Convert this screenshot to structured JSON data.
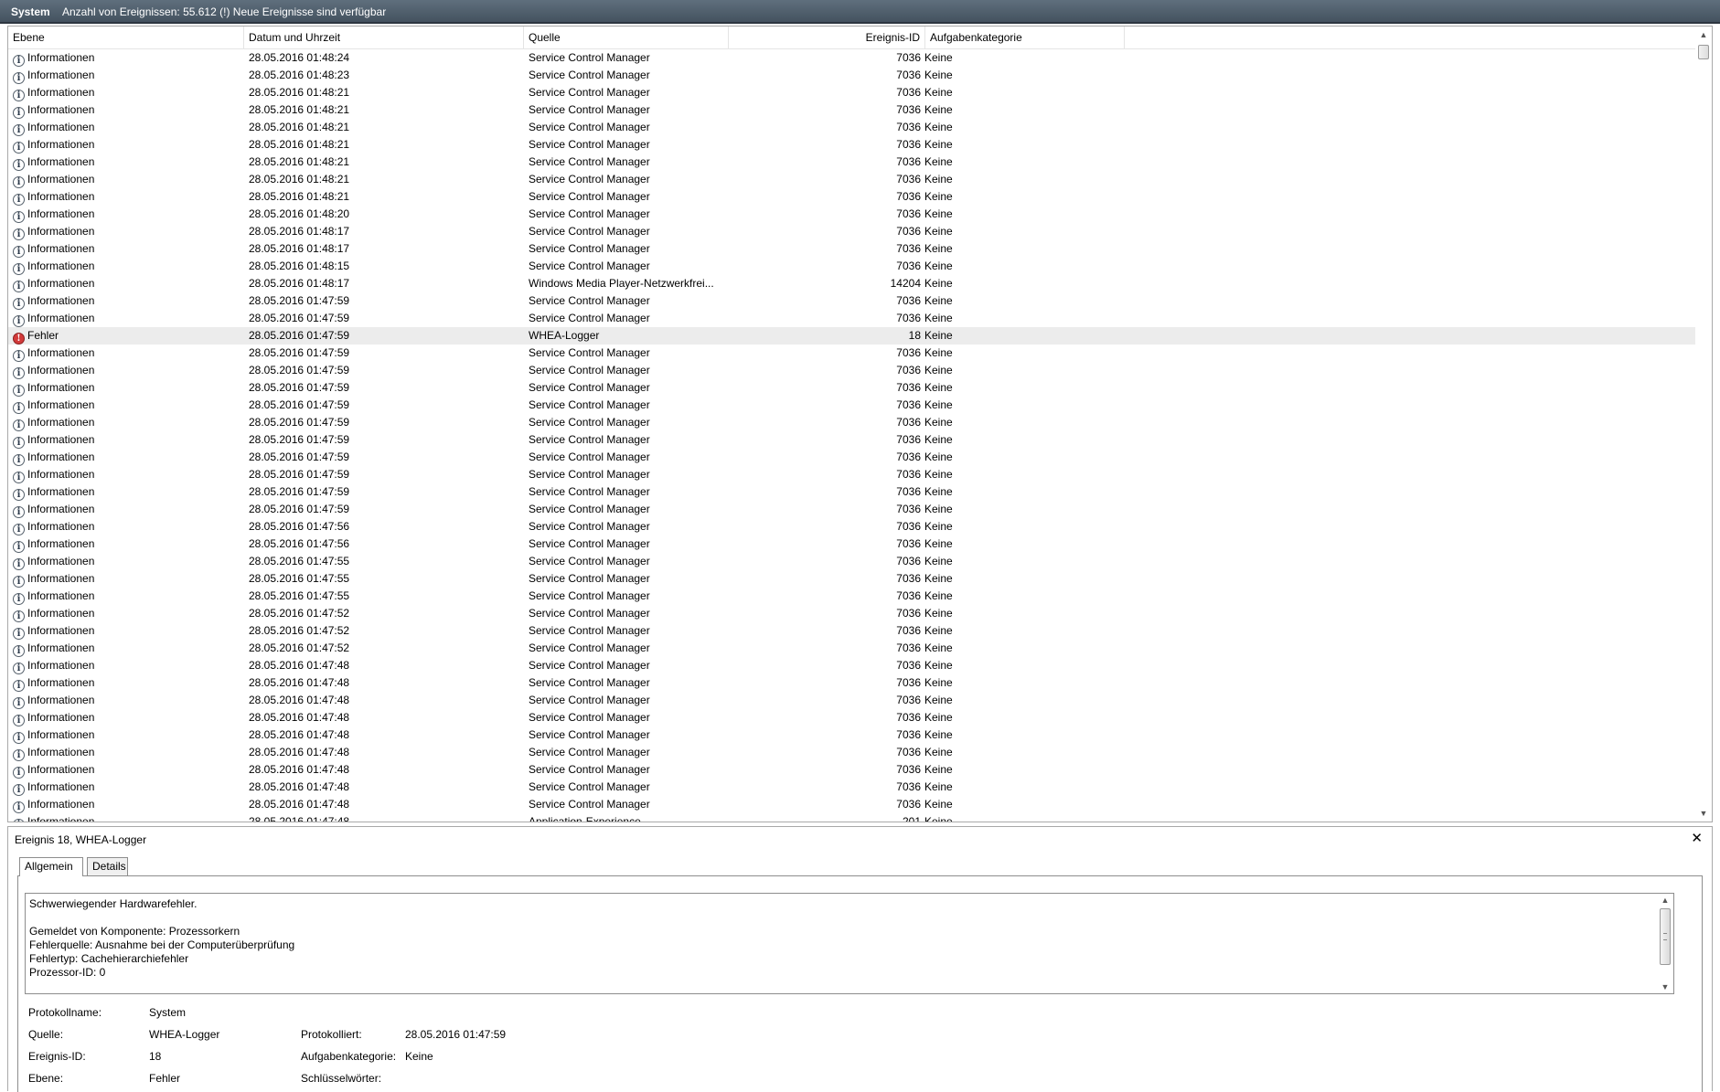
{
  "header": {
    "title": "System",
    "count_text": "Anzahl von Ereignissen: 55.612 (!) Neue Ereignisse sind verfügbar"
  },
  "columns": [
    "Ebene",
    "Datum und Uhrzeit",
    "Quelle",
    "Ereignis-ID",
    "Aufgabenkategorie"
  ],
  "icons": {
    "info": "information-icon",
    "error": "error-icon"
  },
  "colors": {
    "selected_row": "#ececec",
    "error_icon": "#d23a3a",
    "title_bar": "#4f5d6a"
  },
  "events": [
    {
      "level": "Informationen",
      "date": "28.05.2016 01:48:24",
      "source": "Service Control Manager",
      "id": "7036",
      "category": "Keine"
    },
    {
      "level": "Informationen",
      "date": "28.05.2016 01:48:23",
      "source": "Service Control Manager",
      "id": "7036",
      "category": "Keine"
    },
    {
      "level": "Informationen",
      "date": "28.05.2016 01:48:21",
      "source": "Service Control Manager",
      "id": "7036",
      "category": "Keine"
    },
    {
      "level": "Informationen",
      "date": "28.05.2016 01:48:21",
      "source": "Service Control Manager",
      "id": "7036",
      "category": "Keine"
    },
    {
      "level": "Informationen",
      "date": "28.05.2016 01:48:21",
      "source": "Service Control Manager",
      "id": "7036",
      "category": "Keine"
    },
    {
      "level": "Informationen",
      "date": "28.05.2016 01:48:21",
      "source": "Service Control Manager",
      "id": "7036",
      "category": "Keine"
    },
    {
      "level": "Informationen",
      "date": "28.05.2016 01:48:21",
      "source": "Service Control Manager",
      "id": "7036",
      "category": "Keine"
    },
    {
      "level": "Informationen",
      "date": "28.05.2016 01:48:21",
      "source": "Service Control Manager",
      "id": "7036",
      "category": "Keine"
    },
    {
      "level": "Informationen",
      "date": "28.05.2016 01:48:21",
      "source": "Service Control Manager",
      "id": "7036",
      "category": "Keine"
    },
    {
      "level": "Informationen",
      "date": "28.05.2016 01:48:20",
      "source": "Service Control Manager",
      "id": "7036",
      "category": "Keine"
    },
    {
      "level": "Informationen",
      "date": "28.05.2016 01:48:17",
      "source": "Service Control Manager",
      "id": "7036",
      "category": "Keine"
    },
    {
      "level": "Informationen",
      "date": "28.05.2016 01:48:17",
      "source": "Service Control Manager",
      "id": "7036",
      "category": "Keine"
    },
    {
      "level": "Informationen",
      "date": "28.05.2016 01:48:15",
      "source": "Service Control Manager",
      "id": "7036",
      "category": "Keine"
    },
    {
      "level": "Informationen",
      "date": "28.05.2016 01:48:17",
      "source": "Windows Media Player-Netzwerkfrei...",
      "id": "14204",
      "category": "Keine"
    },
    {
      "level": "Informationen",
      "date": "28.05.2016 01:47:59",
      "source": "Service Control Manager",
      "id": "7036",
      "category": "Keine"
    },
    {
      "level": "Informationen",
      "date": "28.05.2016 01:47:59",
      "source": "Service Control Manager",
      "id": "7036",
      "category": "Keine"
    },
    {
      "level": "Fehler",
      "date": "28.05.2016 01:47:59",
      "source": "WHEA-Logger",
      "id": "18",
      "category": "Keine",
      "selected": true
    },
    {
      "level": "Informationen",
      "date": "28.05.2016 01:47:59",
      "source": "Service Control Manager",
      "id": "7036",
      "category": "Keine"
    },
    {
      "level": "Informationen",
      "date": "28.05.2016 01:47:59",
      "source": "Service Control Manager",
      "id": "7036",
      "category": "Keine"
    },
    {
      "level": "Informationen",
      "date": "28.05.2016 01:47:59",
      "source": "Service Control Manager",
      "id": "7036",
      "category": "Keine"
    },
    {
      "level": "Informationen",
      "date": "28.05.2016 01:47:59",
      "source": "Service Control Manager",
      "id": "7036",
      "category": "Keine"
    },
    {
      "level": "Informationen",
      "date": "28.05.2016 01:47:59",
      "source": "Service Control Manager",
      "id": "7036",
      "category": "Keine"
    },
    {
      "level": "Informationen",
      "date": "28.05.2016 01:47:59",
      "source": "Service Control Manager",
      "id": "7036",
      "category": "Keine"
    },
    {
      "level": "Informationen",
      "date": "28.05.2016 01:47:59",
      "source": "Service Control Manager",
      "id": "7036",
      "category": "Keine"
    },
    {
      "level": "Informationen",
      "date": "28.05.2016 01:47:59",
      "source": "Service Control Manager",
      "id": "7036",
      "category": "Keine"
    },
    {
      "level": "Informationen",
      "date": "28.05.2016 01:47:59",
      "source": "Service Control Manager",
      "id": "7036",
      "category": "Keine"
    },
    {
      "level": "Informationen",
      "date": "28.05.2016 01:47:59",
      "source": "Service Control Manager",
      "id": "7036",
      "category": "Keine"
    },
    {
      "level": "Informationen",
      "date": "28.05.2016 01:47:56",
      "source": "Service Control Manager",
      "id": "7036",
      "category": "Keine"
    },
    {
      "level": "Informationen",
      "date": "28.05.2016 01:47:56",
      "source": "Service Control Manager",
      "id": "7036",
      "category": "Keine"
    },
    {
      "level": "Informationen",
      "date": "28.05.2016 01:47:55",
      "source": "Service Control Manager",
      "id": "7036",
      "category": "Keine"
    },
    {
      "level": "Informationen",
      "date": "28.05.2016 01:47:55",
      "source": "Service Control Manager",
      "id": "7036",
      "category": "Keine"
    },
    {
      "level": "Informationen",
      "date": "28.05.2016 01:47:55",
      "source": "Service Control Manager",
      "id": "7036",
      "category": "Keine"
    },
    {
      "level": "Informationen",
      "date": "28.05.2016 01:47:52",
      "source": "Service Control Manager",
      "id": "7036",
      "category": "Keine"
    },
    {
      "level": "Informationen",
      "date": "28.05.2016 01:47:52",
      "source": "Service Control Manager",
      "id": "7036",
      "category": "Keine"
    },
    {
      "level": "Informationen",
      "date": "28.05.2016 01:47:52",
      "source": "Service Control Manager",
      "id": "7036",
      "category": "Keine"
    },
    {
      "level": "Informationen",
      "date": "28.05.2016 01:47:48",
      "source": "Service Control Manager",
      "id": "7036",
      "category": "Keine"
    },
    {
      "level": "Informationen",
      "date": "28.05.2016 01:47:48",
      "source": "Service Control Manager",
      "id": "7036",
      "category": "Keine"
    },
    {
      "level": "Informationen",
      "date": "28.05.2016 01:47:48",
      "source": "Service Control Manager",
      "id": "7036",
      "category": "Keine"
    },
    {
      "level": "Informationen",
      "date": "28.05.2016 01:47:48",
      "source": "Service Control Manager",
      "id": "7036",
      "category": "Keine"
    },
    {
      "level": "Informationen",
      "date": "28.05.2016 01:47:48",
      "source": "Service Control Manager",
      "id": "7036",
      "category": "Keine"
    },
    {
      "level": "Informationen",
      "date": "28.05.2016 01:47:48",
      "source": "Service Control Manager",
      "id": "7036",
      "category": "Keine"
    },
    {
      "level": "Informationen",
      "date": "28.05.2016 01:47:48",
      "source": "Service Control Manager",
      "id": "7036",
      "category": "Keine"
    },
    {
      "level": "Informationen",
      "date": "28.05.2016 01:47:48",
      "source": "Service Control Manager",
      "id": "7036",
      "category": "Keine"
    },
    {
      "level": "Informationen",
      "date": "28.05.2016 01:47:48",
      "source": "Service Control Manager",
      "id": "7036",
      "category": "Keine"
    },
    {
      "level": "Informationen",
      "date": "28.05.2016 01:47:48",
      "source": "Application-Experience",
      "id": "201",
      "category": "Keine"
    }
  ],
  "detail": {
    "title": "Ereignis 18, WHEA-Logger",
    "tabs": [
      "Allgemein",
      "Details"
    ],
    "message_lines": [
      "Schwerwiegender Hardwarefehler.",
      "",
      "Gemeldet von Komponente: Prozessorkern",
      "Fehlerquelle: Ausnahme bei der Computerüberprüfung",
      "Fehlertyp: Cachehierarchiefehler",
      "Prozessor-ID: 0"
    ],
    "props": {
      "log_name_label": "Protokollname:",
      "log_name": "System",
      "source_label": "Quelle:",
      "source": "WHEA-Logger",
      "logged_label": "Protokolliert:",
      "logged": "28.05.2016 01:47:59",
      "event_id_label": "Ereignis-ID:",
      "event_id": "18",
      "task_cat_label": "Aufgabenkategorie:",
      "task_cat": "Keine",
      "level_label": "Ebene:",
      "level": "Fehler",
      "keywords_label": "Schlüsselwörter:"
    }
  }
}
